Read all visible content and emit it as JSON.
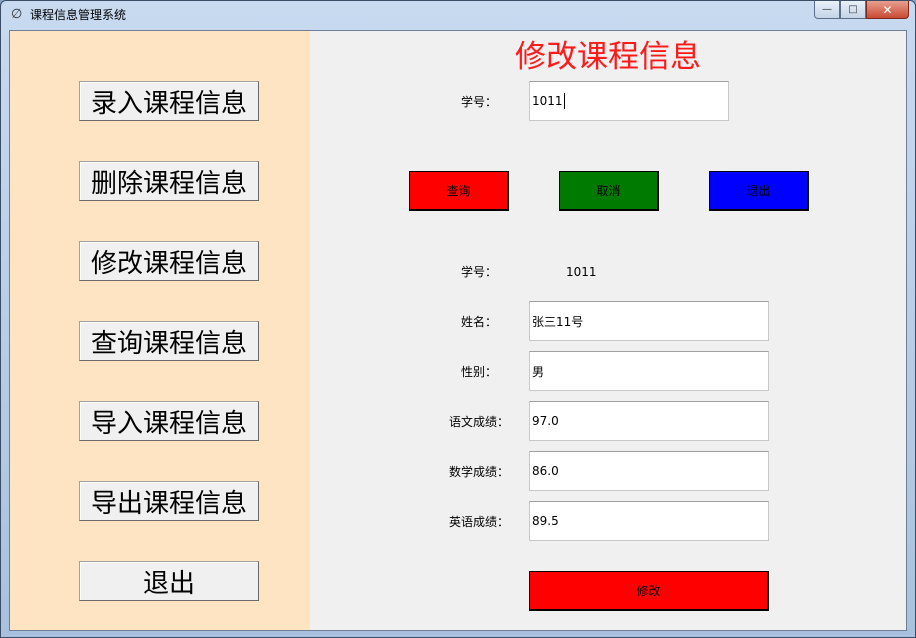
{
  "window": {
    "title": "课程信息管理系统",
    "minimize_glyph": "—",
    "maximize_glyph": "□",
    "close_glyph": "✕",
    "app_icon_glyph": "∅"
  },
  "sidebar": {
    "items": [
      {
        "label": "录入课程信息"
      },
      {
        "label": "删除课程信息"
      },
      {
        "label": "修改课程信息"
      },
      {
        "label": "查询课程信息"
      },
      {
        "label": "导入课程信息"
      },
      {
        "label": "导出课程信息"
      },
      {
        "label": "退出"
      }
    ]
  },
  "main": {
    "heading": "修改课程信息",
    "search": {
      "label": "学号：",
      "value": "1011"
    },
    "actions": {
      "query_label": "查询",
      "cancel_label": "取消",
      "exit_label": "退出"
    },
    "record": {
      "id_label": "学号：",
      "id_value": "1011",
      "name_label": "姓名：",
      "name_value": "张三11号",
      "gender_label": "性别：",
      "gender_value": "男",
      "chinese_label": "语文成绩：",
      "chinese_value": "97.0",
      "math_label": "数学成绩：",
      "math_value": "86.0",
      "english_label": "英语成绩：",
      "english_value": "89.5"
    },
    "submit_label": "修改"
  },
  "colors": {
    "sidebar_bg": "#ffe4c4",
    "heading": "#ff1a1a",
    "query_button": "#ff0000",
    "cancel_button": "#007a00",
    "exit_button": "#0000ff",
    "submit_button": "#ff0000"
  }
}
